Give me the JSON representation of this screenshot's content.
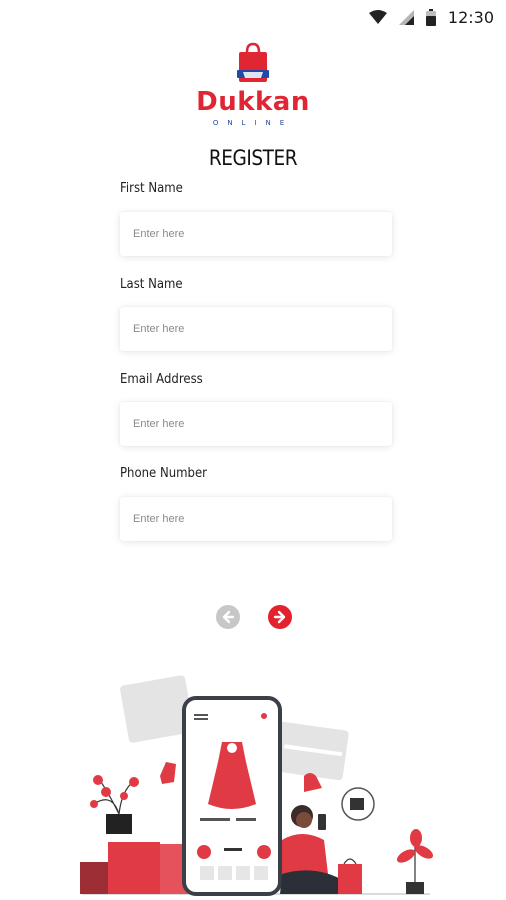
{
  "status_bar": {
    "time": "12:30",
    "icons": [
      "wifi-icon",
      "signal-icon",
      "battery-icon"
    ]
  },
  "logo": {
    "name": "Dukkan",
    "tagline": "ONLINE"
  },
  "page": {
    "title": "REGISTER"
  },
  "form": {
    "fields": [
      {
        "label": "First Name",
        "placeholder": "Enter here",
        "value": ""
      },
      {
        "label": "Last Name",
        "placeholder": "Enter here",
        "value": ""
      },
      {
        "label": "Email Address",
        "placeholder": "Enter here",
        "value": ""
      },
      {
        "label": "Phone Number",
        "placeholder": "Enter here",
        "value": ""
      }
    ]
  },
  "navigation": {
    "prev_icon": "arrow-left-circle-icon",
    "next_icon": "arrow-right-circle-icon"
  },
  "colors": {
    "brand_red": "#e02633",
    "brand_blue": "#1f4aa8",
    "disabled_gray": "#c7c7c7",
    "illustration_red": "#e03a44"
  }
}
